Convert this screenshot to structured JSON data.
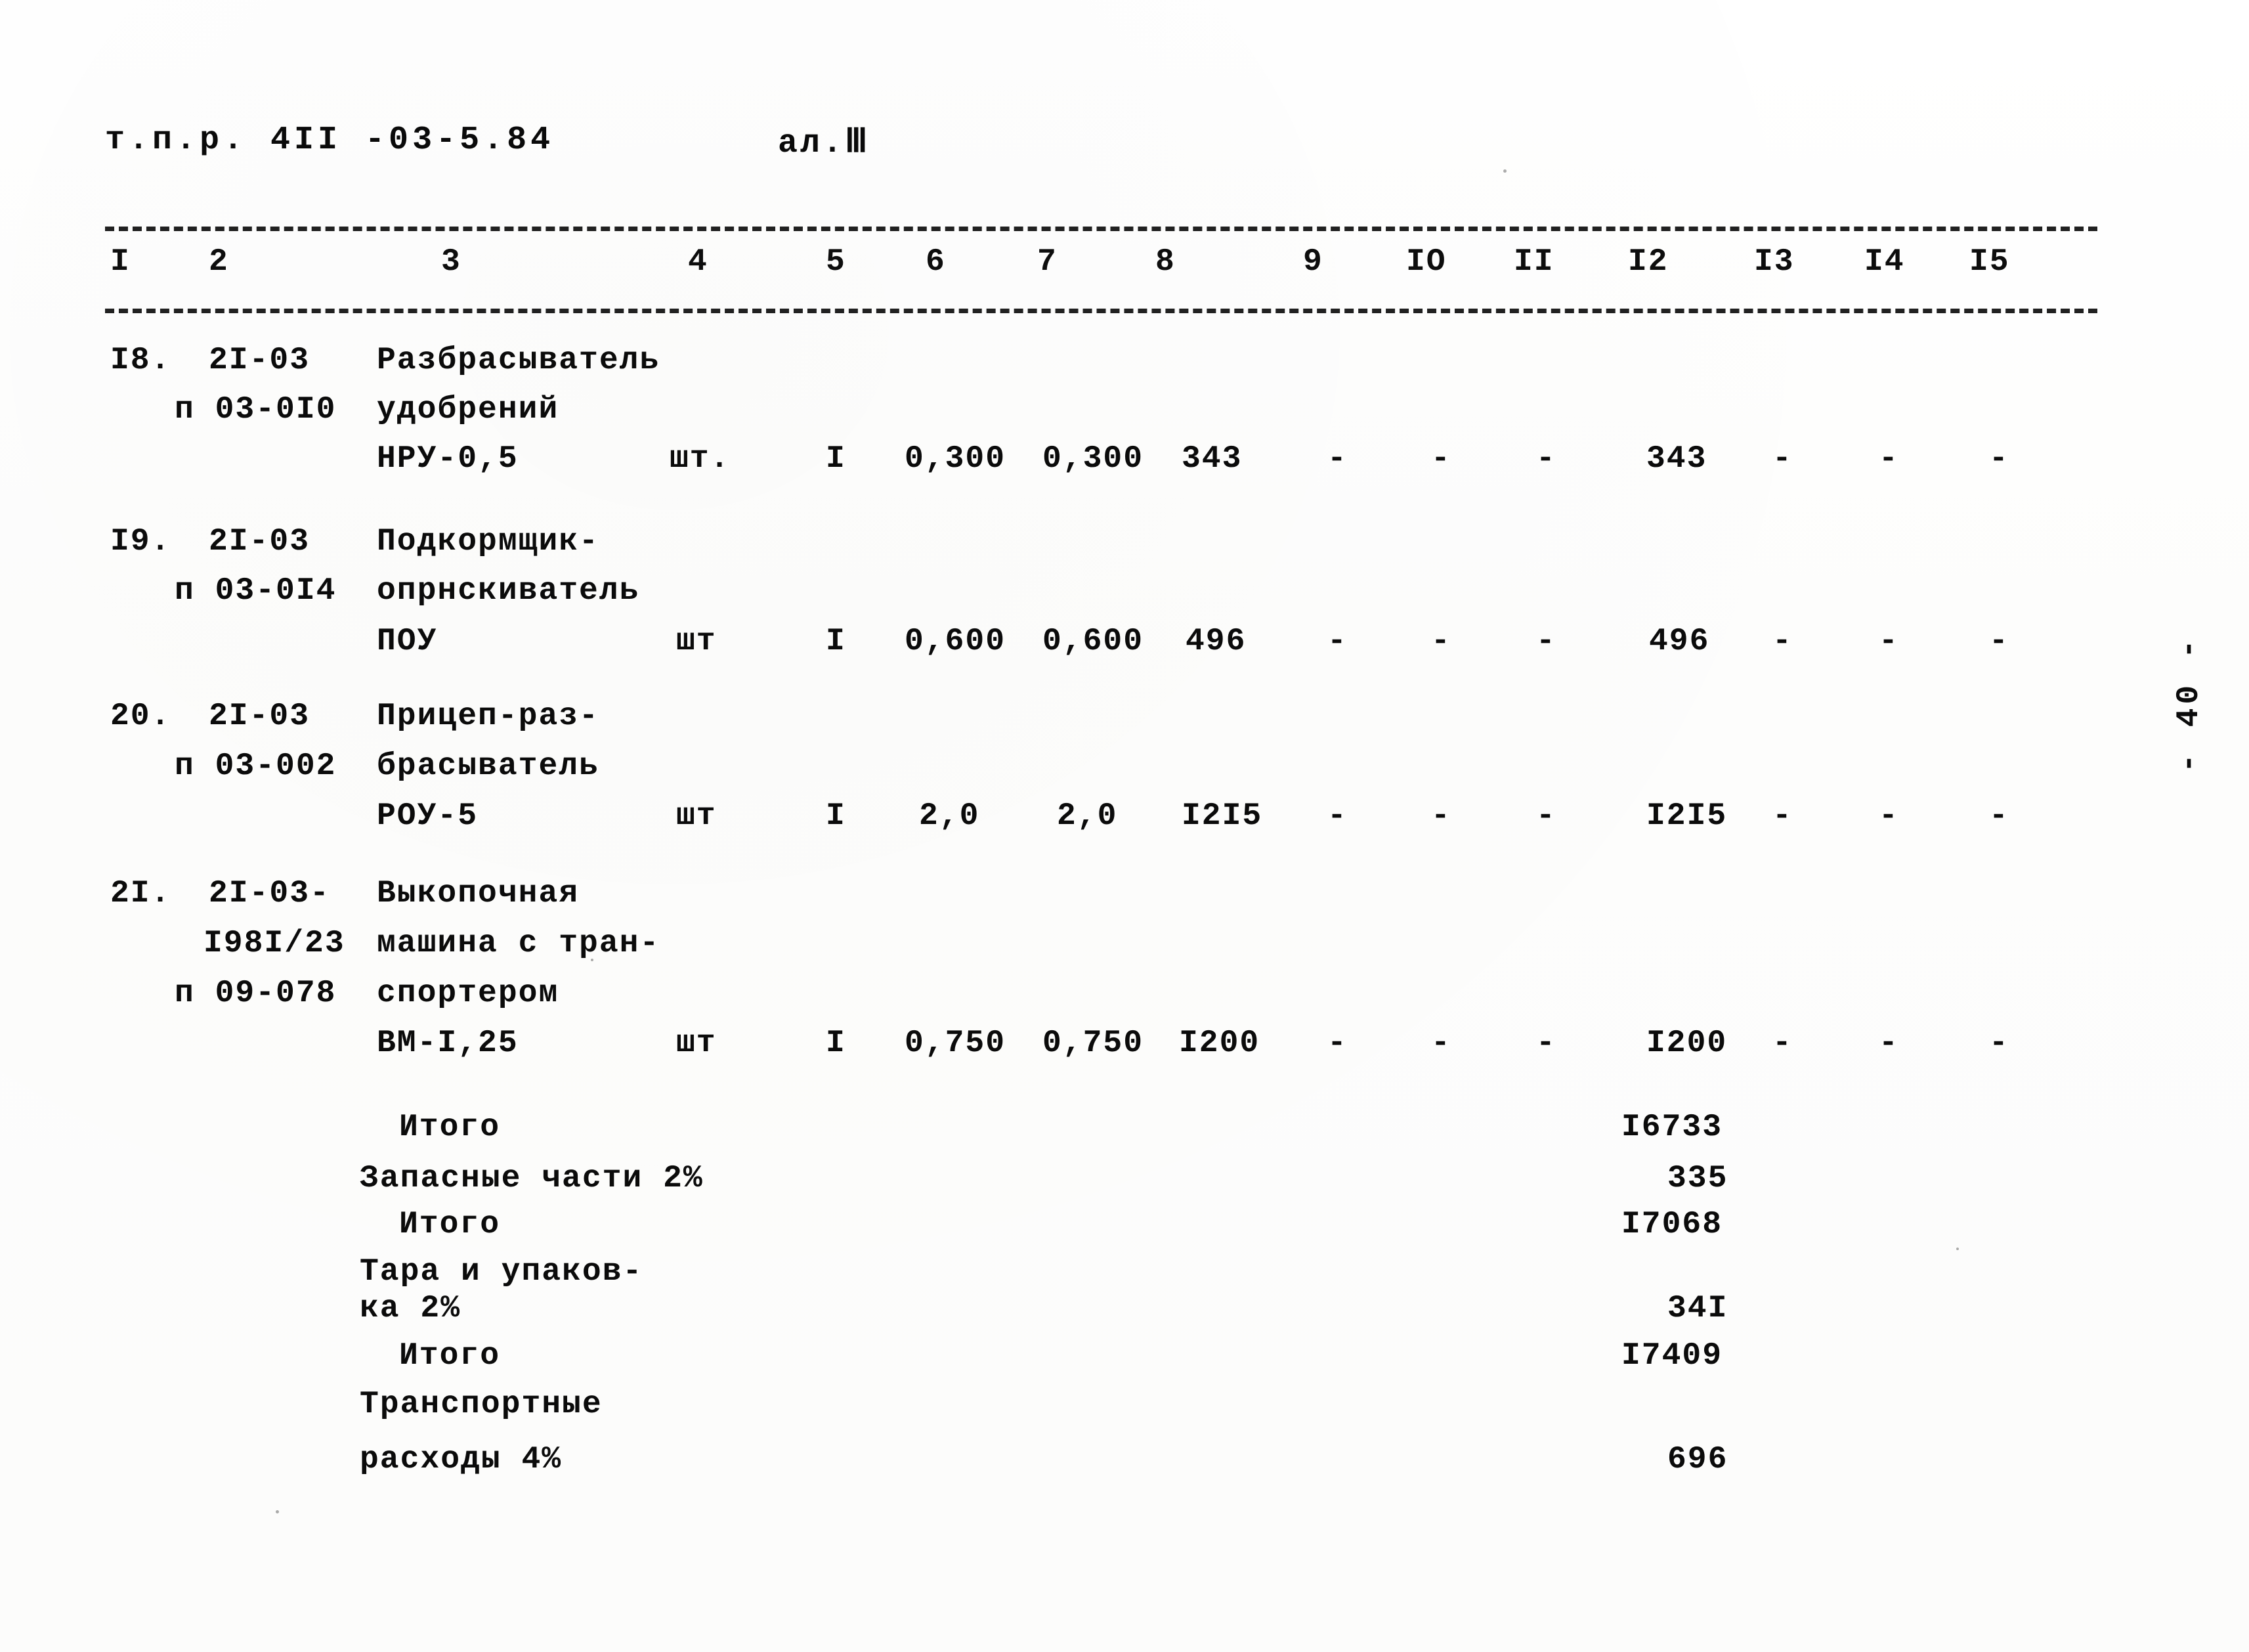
{
  "document": {
    "id_line": "т.п.р. 4II -03-5.84",
    "appendix_label": "ал.Ⅲ",
    "page_marker": "- 40 -"
  },
  "table": {
    "column_headers": [
      "I",
      "2",
      "3",
      "4",
      "5",
      "6",
      "7",
      "8",
      "9",
      "IO",
      "II",
      "I2",
      "I3",
      "I4",
      "I5"
    ],
    "rows": [
      {
        "no": "I8.",
        "code_lines": [
          "2I-03",
          "п 03-0I0",
          ""
        ],
        "name_lines": [
          "Разбрасыватель",
          "удобрений",
          "НРУ-0,5"
        ],
        "unit": "шт.",
        "qty": "I",
        "c6": "0,300",
        "c7": "0,300",
        "c8": "343",
        "c9": "-",
        "c10": "-",
        "c11": "-",
        "c12": "343",
        "c13": "-",
        "c14": "-",
        "c15": "-"
      },
      {
        "no": "I9.",
        "code_lines": [
          "2I-03",
          "п 03-0I4",
          ""
        ],
        "name_lines": [
          "Подкормщик-",
          "опрнскиватель",
          "ПОУ"
        ],
        "unit": "шт",
        "qty": "I",
        "c6": "0,600",
        "c7": "0,600",
        "c8": "496",
        "c9": "-",
        "c10": "-",
        "c11": "-",
        "c12": "496",
        "c13": "-",
        "c14": "-",
        "c15": "-"
      },
      {
        "no": "20.",
        "code_lines": [
          "2I-03",
          "п 03-002",
          ""
        ],
        "name_lines": [
          "Прицеп-раз-",
          "брасыватель",
          "РОУ-5"
        ],
        "unit": "шт",
        "qty": "I",
        "c6": "2,0",
        "c7": "2,0",
        "c8": "I2I5",
        "c9": "-",
        "c10": "-",
        "c11": "-",
        "c12": "I2I5",
        "c13": "-",
        "c14": "-",
        "c15": "-"
      },
      {
        "no": "2I.",
        "code_lines": [
          "2I-03-",
          "I98I/23",
          "п 09-078",
          ""
        ],
        "name_lines": [
          "Выкопочная",
          "машина с тран-",
          "спортером",
          "ВМ-I,25"
        ],
        "unit": "шт",
        "qty": "I",
        "c6": "0,750",
        "c7": "0,750",
        "c8": "I200",
        "c9": "-",
        "c10": "-",
        "c11": "-",
        "c12": "I200",
        "c13": "-",
        "c14": "-",
        "c15": "-"
      }
    ]
  },
  "summary": [
    {
      "label": "Итого",
      "value": "I6733"
    },
    {
      "label": "Запасные части 2%",
      "value": "335"
    },
    {
      "label": "Итого",
      "value": "I7068"
    },
    {
      "label": "Тара и упаков-",
      "label2": "ка 2%",
      "value": "34I"
    },
    {
      "label": "Итого",
      "value": "I7409"
    },
    {
      "label": "Транспортные",
      "label2": "расходы 4%",
      "value": "696"
    }
  ]
}
